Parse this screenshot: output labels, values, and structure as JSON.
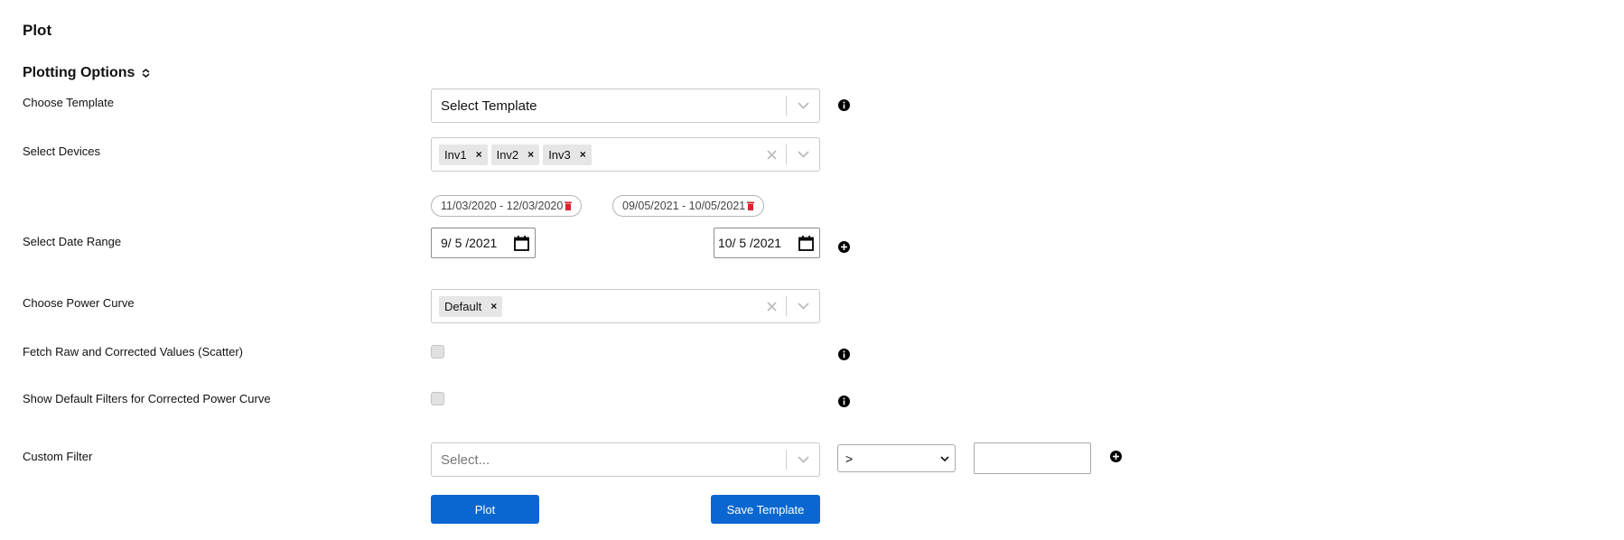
{
  "page": {
    "title": "Plot"
  },
  "plotting_options": {
    "title": "Plotting Options",
    "choose_template": {
      "label": "Choose Template",
      "placeholder": "Select Template"
    },
    "select_devices": {
      "label": "Select Devices",
      "tags": [
        "Inv1",
        "Inv2",
        "Inv3"
      ]
    },
    "date_range": {
      "label": "Select Date Range",
      "chips": [
        "11/03/2020 - 12/03/2020",
        "09/05/2021 - 10/05/2021"
      ],
      "start_value": "9/ 5 /2021",
      "end_value": "10/ 5 /2021"
    },
    "power_curve": {
      "label": "Choose Power Curve",
      "tags": [
        "Default"
      ]
    },
    "fetch_raw": {
      "label": "Fetch Raw and Corrected Values (Scatter)",
      "checked": false
    },
    "default_filters": {
      "label": "Show Default Filters for Corrected Power Curve",
      "checked": false
    },
    "custom_filter": {
      "label": "Custom Filter",
      "placeholder": "Select...",
      "operator": ">",
      "value": ""
    },
    "buttons": {
      "plot": "Plot",
      "save_template": "Save Template"
    }
  },
  "colors": {
    "primary": "#0a67d1",
    "delete": "#e0212e"
  }
}
